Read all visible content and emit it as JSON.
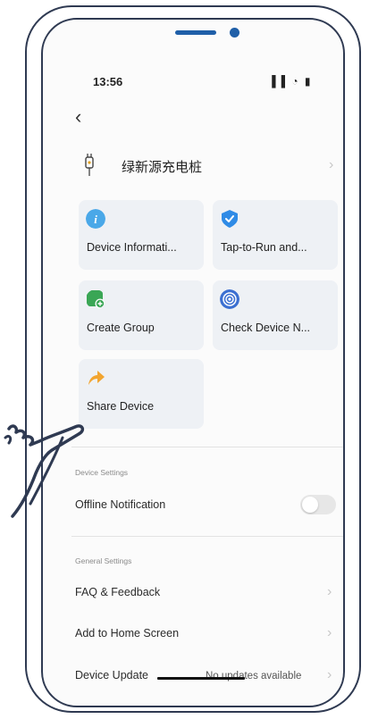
{
  "status_bar": {
    "time": "13:56",
    "icons_text": "▐▐ ◔ ▮"
  },
  "header": {
    "back_icon": "chevron-left-icon",
    "back_glyph": "‹"
  },
  "device": {
    "name": "绿新源充电桩",
    "icon": "charger-plug-icon"
  },
  "tiles": [
    {
      "label": "Device Informati...",
      "icon": "info-icon",
      "color": "#4aa8e8"
    },
    {
      "label": "Tap-to-Run and...",
      "icon": "shield-check-icon",
      "color": "#2f8be6"
    },
    {
      "label": "Create Group",
      "icon": "group-add-icon",
      "color": "#3aa655"
    },
    {
      "label": "Check Device N...",
      "icon": "network-signal-icon",
      "color": "#3b6fd1"
    },
    {
      "label": "Share Device",
      "icon": "share-arrow-icon",
      "color": "#f2a530"
    }
  ],
  "device_settings": {
    "section_label": "Device Settings",
    "offline_notification": {
      "label": "Offline Notification",
      "enabled": false
    }
  },
  "general_settings": {
    "section_label": "General Settings",
    "faq": "FAQ & Feedback",
    "add_home": "Add to Home Screen",
    "device_update": "Device Update",
    "update_value": "No updates available"
  },
  "glyphs": {
    "chevron_right": "›"
  },
  "colors": {
    "frame": "#2f3a52",
    "tile_bg": "#eef1f5",
    "notch": "#1f5fa8"
  }
}
